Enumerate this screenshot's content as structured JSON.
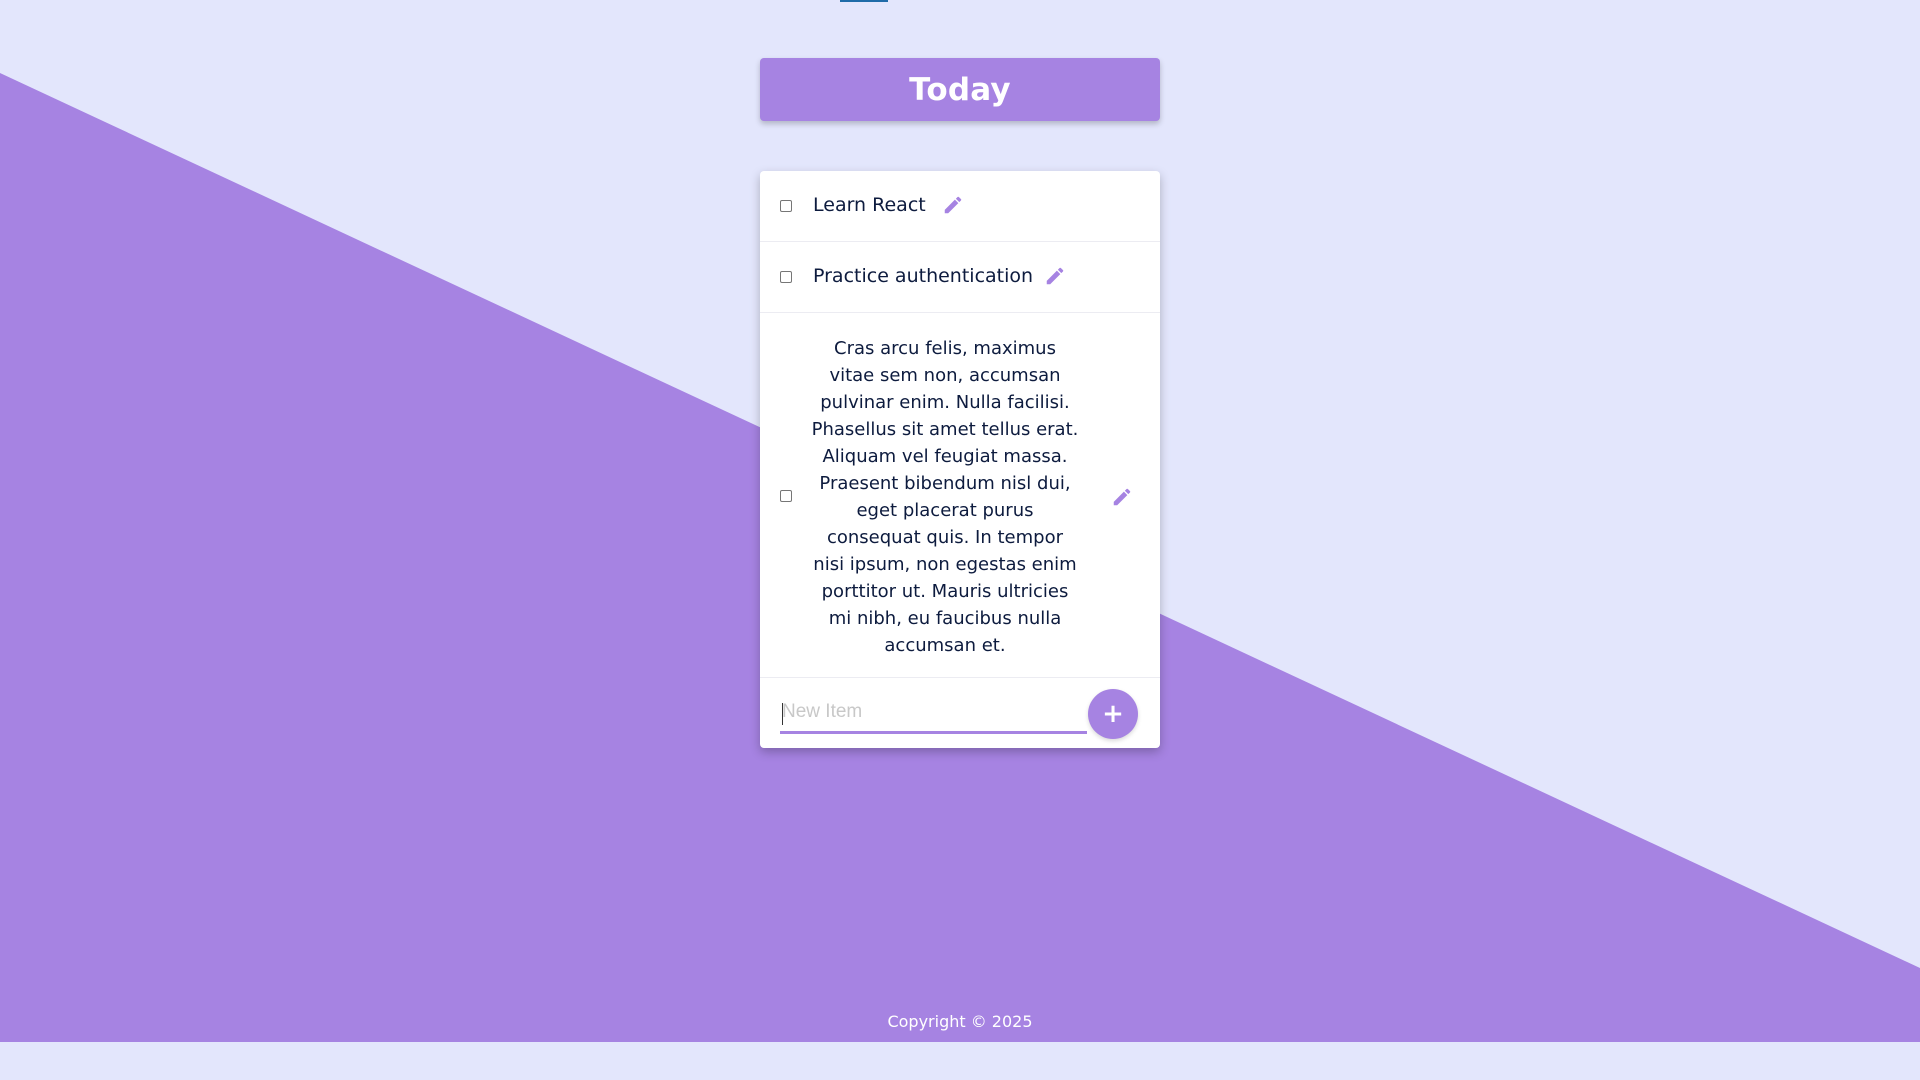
{
  "header": {
    "title": "Today"
  },
  "items": [
    {
      "label": "Learn React",
      "checked": false,
      "edit_icon": "pencil-icon"
    },
    {
      "label": "Practice authentication",
      "checked": false,
      "edit_icon": "pencil-icon"
    },
    {
      "label": "Cras arcu felis, maximus vitae sem non, accumsan pulvinar enim. Nulla facilisi. Phasellus sit amet tellus erat. Aliquam vel feugiat massa. Praesent bibendum nisl dui, eget placerat purus consequat quis. In tempor nisi ipsum, non egestas enim porttitor ut. Mauris ultricies mi nibh, eu faucibus nulla accumsan et.",
      "checked": false,
      "edit_icon": "pencil-icon"
    }
  ],
  "new_item": {
    "placeholder": "New Item",
    "value": "",
    "add_label": "+"
  },
  "footer": {
    "text": "Copyright © 2025"
  },
  "colors": {
    "accent": "#a683e2",
    "background": "#e3e6fc",
    "text": "#0d1b3e"
  }
}
